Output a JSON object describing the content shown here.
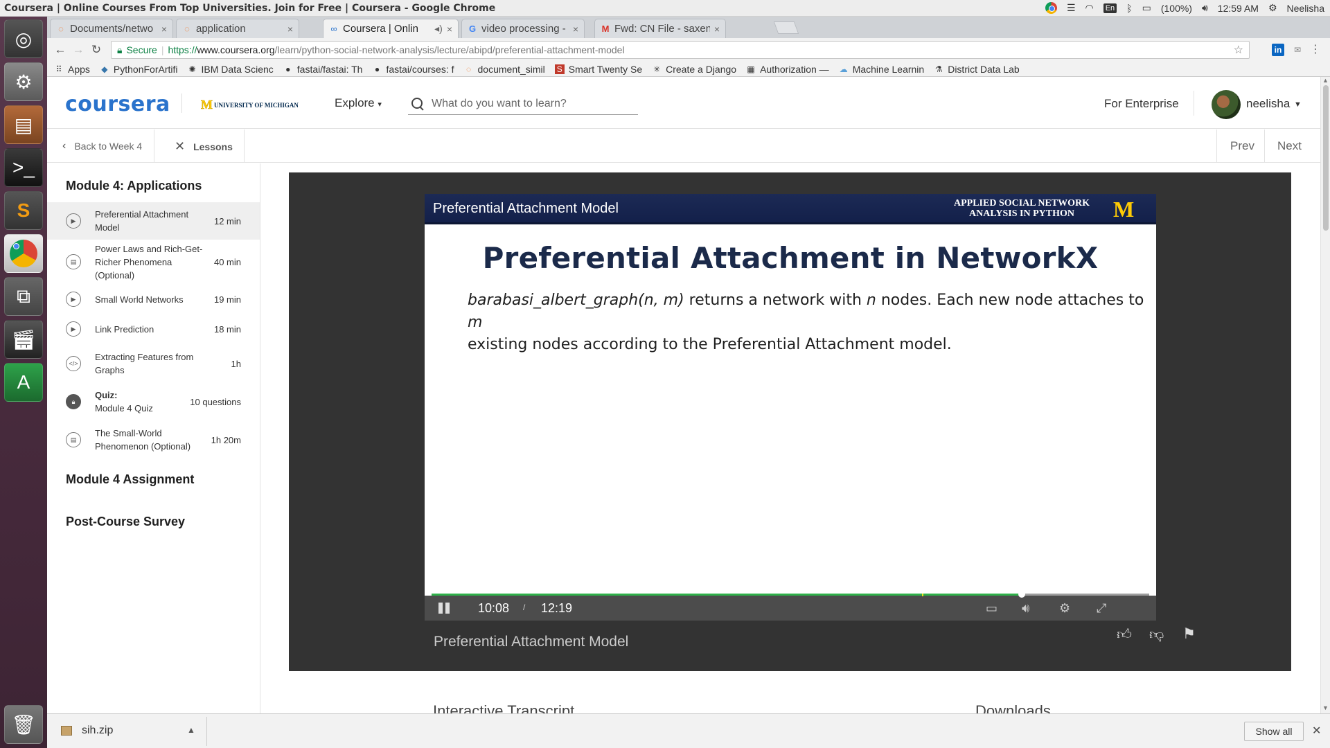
{
  "system": {
    "window_title": "Coursera | Online Courses From Top Universities. Join for Free | Coursera - Google Chrome",
    "keyboard": "En",
    "battery": "(100%)",
    "time": "12:59 AM",
    "user": "Neelisha"
  },
  "tabs": [
    {
      "label": "Documents/netwo",
      "icon": "jupyter-icon"
    },
    {
      "label": "application",
      "icon": "jupyter-icon"
    },
    {
      "label": "Coursera | Onlin",
      "icon": "coursera-icon",
      "audio": true
    },
    {
      "label": "video processing - ",
      "icon": "google-icon"
    },
    {
      "label": "Fwd: CN File - saxen",
      "icon": "gmail-icon"
    }
  ],
  "omnibox": {
    "secure_label": "Secure",
    "url_scheme": "https://",
    "url_host": "www.coursera.org",
    "url_path": "/learn/python-social-network-analysis/lecture/abipd/preferential-attachment-model"
  },
  "bookmarks": [
    "Apps",
    "PythonForArtifi",
    "IBM Data Scienc",
    "fastai/fastai: Th",
    "fastai/courses: f",
    "document_simil",
    "Smart Twenty Se",
    "Create a Django",
    "Authorization —",
    "Machine Learnin",
    "District Data Lab"
  ],
  "header": {
    "logo": "coursera",
    "partner": "UNIVERSITY OF MICHIGAN",
    "partner_letter": "M",
    "explore": "Explore",
    "search_placeholder": "What do you want to learn?",
    "enterprise": "For Enterprise",
    "username": "neelisha"
  },
  "subheader": {
    "back": "Back to Week 4",
    "lessons": "Lessons",
    "prev": "Prev",
    "next": "Next"
  },
  "sidebar": {
    "module_title": "Module 4: Applications",
    "items": [
      {
        "title": "Preferential Attachment Model",
        "duration": "12 min",
        "type": "video"
      },
      {
        "title": "Power Laws and Rich-Get-Richer Phenomena (Optional)",
        "duration": "40 min",
        "type": "reading"
      },
      {
        "title": "Small World Networks",
        "duration": "19 min",
        "type": "video"
      },
      {
        "title": "Link Prediction",
        "duration": "18 min",
        "type": "video"
      },
      {
        "title": "Extracting Features from Graphs",
        "duration": "1h",
        "type": "code"
      },
      {
        "title_prefix": "Quiz:",
        "title": "Module 4 Quiz",
        "duration": "10 questions",
        "type": "quiz"
      },
      {
        "title": "The Small-World Phenomenon (Optional)",
        "duration": "1h 20m",
        "type": "reading"
      }
    ],
    "assignment": "Module 4 Assignment",
    "survey": "Post-Course Survey"
  },
  "video": {
    "slide_header": "Preferential Attachment Model",
    "slide_brand_line1": "APPLIED SOCIAL NETWORK",
    "slide_brand_line2": "ANALYSIS IN PYTHON",
    "slide_logo": "M",
    "slide_title": "Preferential Attachment in NetworkX",
    "slide_body_fn": "barabasi_albert_graph(n, m)",
    "slide_body_1": " returns a network with ",
    "slide_body_n": "n",
    "slide_body_2": " nodes. Each new node attaches to ",
    "slide_body_m": "m",
    "slide_body_3": "existing nodes according to the Preferential Attachment model.",
    "current_time": "10:08",
    "separator": "/",
    "duration": "12:19",
    "progress_fraction": 0.822,
    "buffered_fraction": 0.683,
    "caption": "Preferential Attachment Model"
  },
  "below": {
    "transcript": "Interactive Transcript",
    "downloads": "Downloads"
  },
  "downloads_bar": {
    "file": "sih.zip",
    "show_all": "Show all"
  },
  "colors": {
    "coursera_blue": "#2a73cc",
    "michigan_maize": "#ffcb05",
    "progress_green": "#2fb14a"
  }
}
